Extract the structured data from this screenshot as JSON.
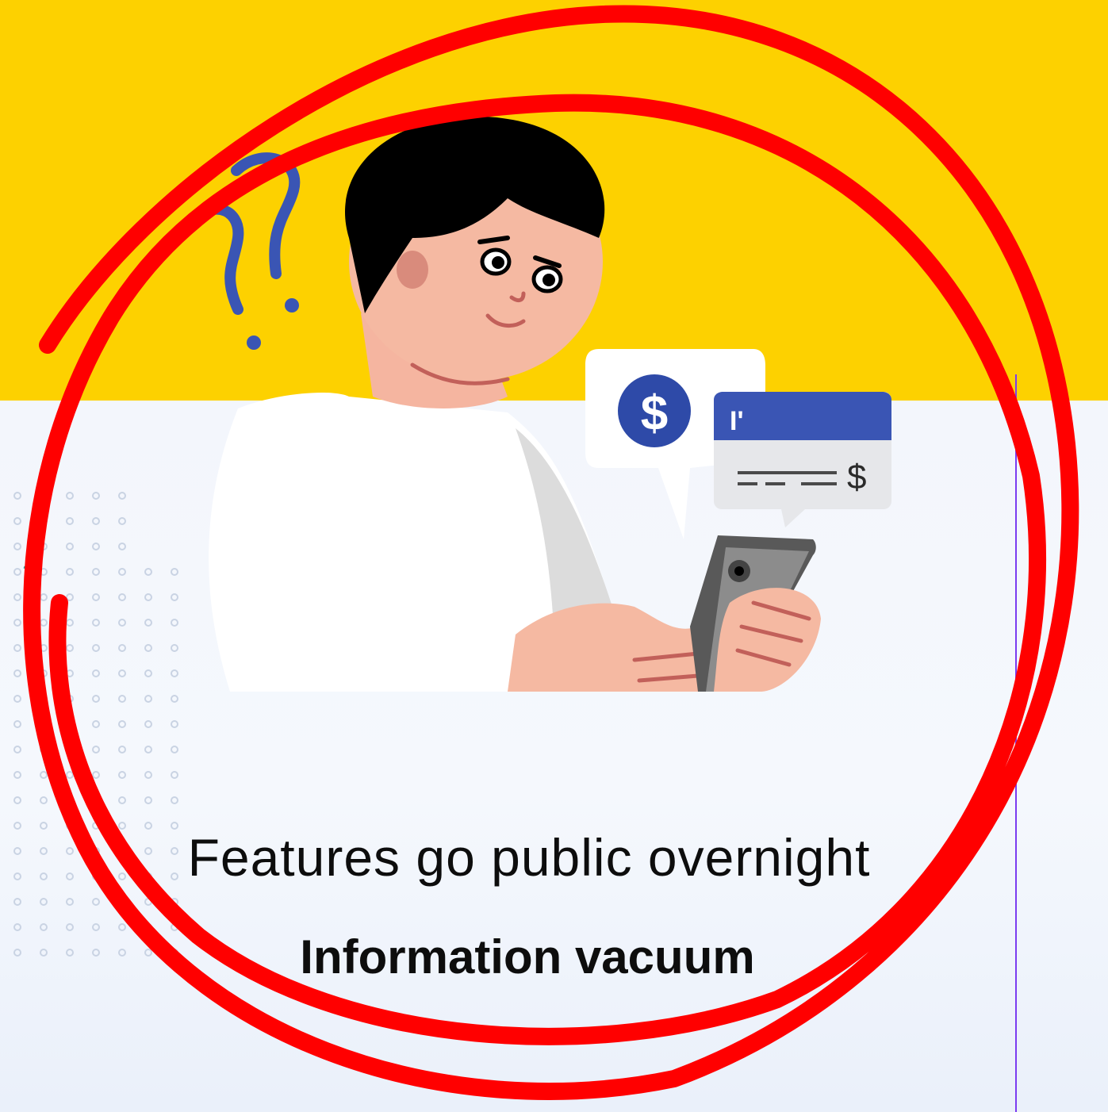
{
  "slide": {
    "headline": "Features go public overnight",
    "subhead": "Information vacuum"
  },
  "bubble": {
    "currency_symbol": "$",
    "check_amount_symbol": "$",
    "check_mark_text": "I'"
  },
  "colors": {
    "yellow": "#fdd100",
    "panel": "#f3f6fc",
    "annotation_red": "#ff0000",
    "accent_blue": "#2e4aa8",
    "divider_purple": "#7b3cf0"
  },
  "icons": [
    "question-marks-icon",
    "dollar-coin-icon",
    "check-card-icon",
    "phone-icon"
  ]
}
